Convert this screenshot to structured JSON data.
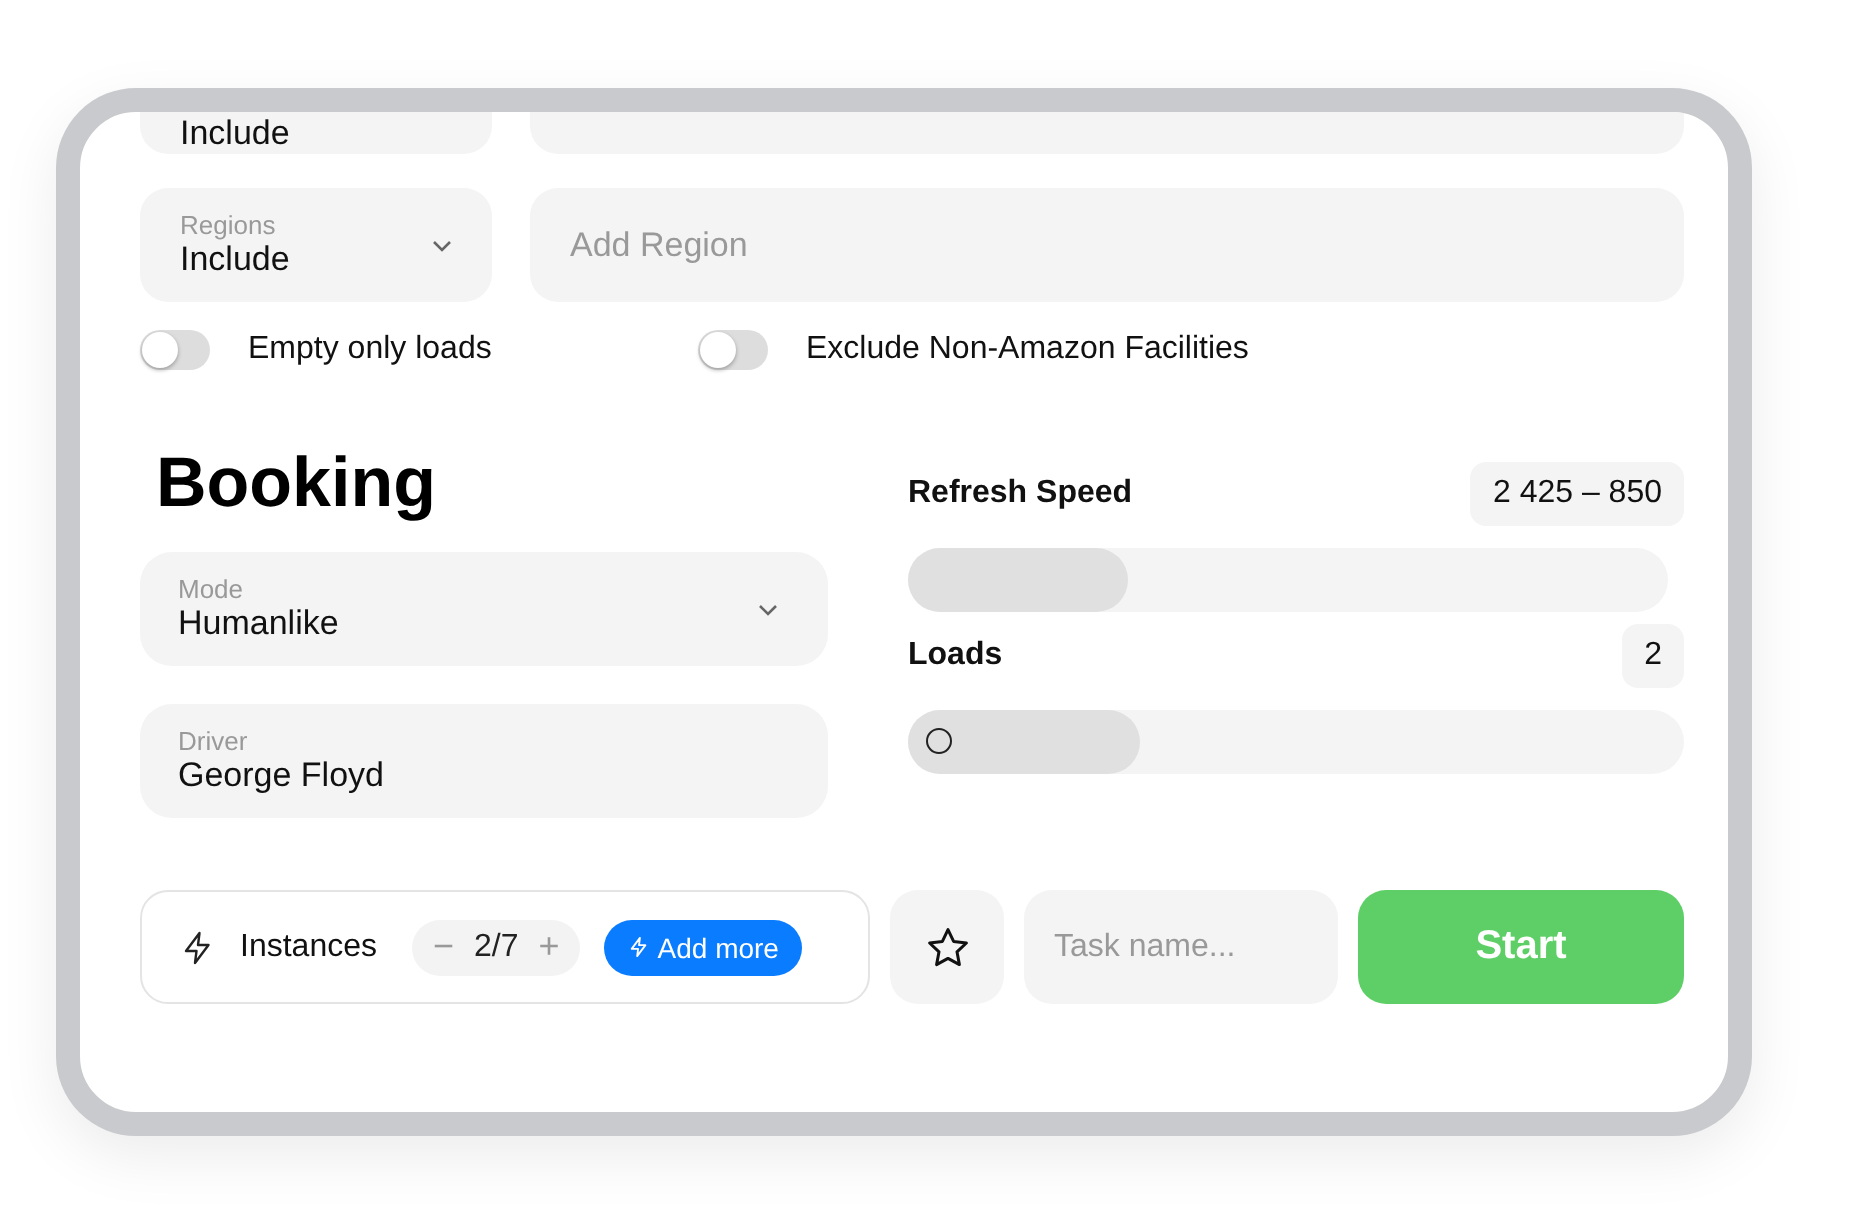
{
  "top_row": {
    "select_value": "Include"
  },
  "regions": {
    "label": "Regions",
    "value": "Include",
    "placeholder": "Add Region"
  },
  "toggles": [
    {
      "label": "Empty only loads",
      "on": false
    },
    {
      "label": "Exclude Non-Amazon Facilities",
      "on": false
    }
  ],
  "booking": {
    "title": "Booking",
    "fields": [
      {
        "kind": "select",
        "label": "Mode",
        "value": "Humanlike"
      },
      {
        "kind": "text",
        "label": "Driver",
        "value": "George Floyd"
      }
    ],
    "sliders": [
      {
        "label": "Refresh Speed",
        "reading": "2 425 – 850",
        "level": 0.29,
        "thumb": false
      },
      {
        "label": "Loads",
        "reading": "2",
        "level": 0.3,
        "thumb": true
      }
    ]
  },
  "footer": {
    "instances_label": "Instances",
    "minus": "−",
    "count": "2/7",
    "plus": "+",
    "add_more": "Add more",
    "task_placeholder": "Task name...",
    "start": "Start"
  }
}
